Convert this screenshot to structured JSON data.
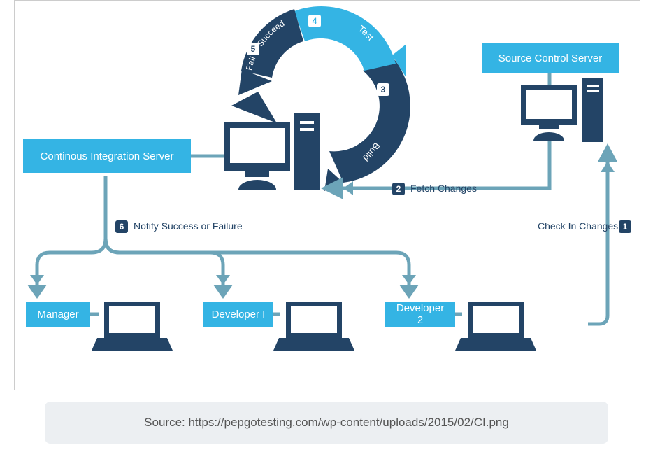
{
  "boxes": {
    "ci_server": "Continous Integration Server",
    "source_control": "Source Control Server",
    "manager": "Manager",
    "dev1": "Developer I",
    "dev2": "Developer 2"
  },
  "steps": {
    "s1": {
      "n": "1",
      "label": "Check In Changes"
    },
    "s2": {
      "n": "2",
      "label": "Fetch Changes"
    },
    "s3": {
      "n": "3",
      "label": "Build"
    },
    "s4": {
      "n": "4",
      "label": "Test"
    },
    "s5": {
      "n": "5",
      "label": "Fail or Succeed"
    },
    "s6": {
      "n": "6",
      "label": "Notify Success or Failure"
    }
  },
  "source_line": "Source: https://pepgotesting.com/wp-content/uploads/2015/02/CI.png",
  "colors": {
    "light": "#34B4E4",
    "dark": "#234466",
    "med": "#6CA4B8"
  }
}
